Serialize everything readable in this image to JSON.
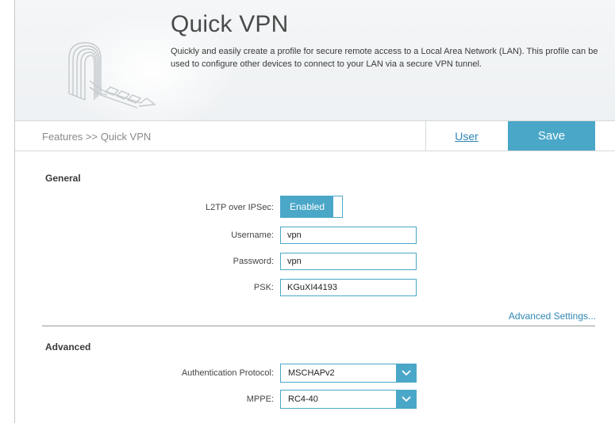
{
  "header": {
    "title": "Quick VPN",
    "description": "Quickly and easily create a profile for secure remote access to a Local Area Network (LAN). This profile can be used to configure other devices to connect to your LAN via a secure VPN tunnel."
  },
  "toolbar": {
    "breadcrumb": "Features >> Quick VPN",
    "user_label": "User",
    "save_label": "Save"
  },
  "general": {
    "title": "General",
    "l2tp_label": "L2TP over IPSec:",
    "l2tp_state": "Enabled",
    "username_label": "Username:",
    "username_value": "vpn",
    "password_label": "Password:",
    "password_value": "vpn",
    "psk_label": "PSK:",
    "psk_value": "KGuXI44193",
    "advanced_link": "Advanced Settings..."
  },
  "advanced": {
    "title": "Advanced",
    "auth_label": "Authentication Protocol:",
    "auth_value": "MSCHAPv2",
    "mppe_label": "MPPE:",
    "mppe_value": "RC4-40"
  },
  "colors": {
    "accent": "#4aa7c8",
    "link": "#2f86b5"
  },
  "icons": {
    "logo": "vpn-tunnel-logo-icon",
    "dropdown": "chevron-down-icon"
  }
}
